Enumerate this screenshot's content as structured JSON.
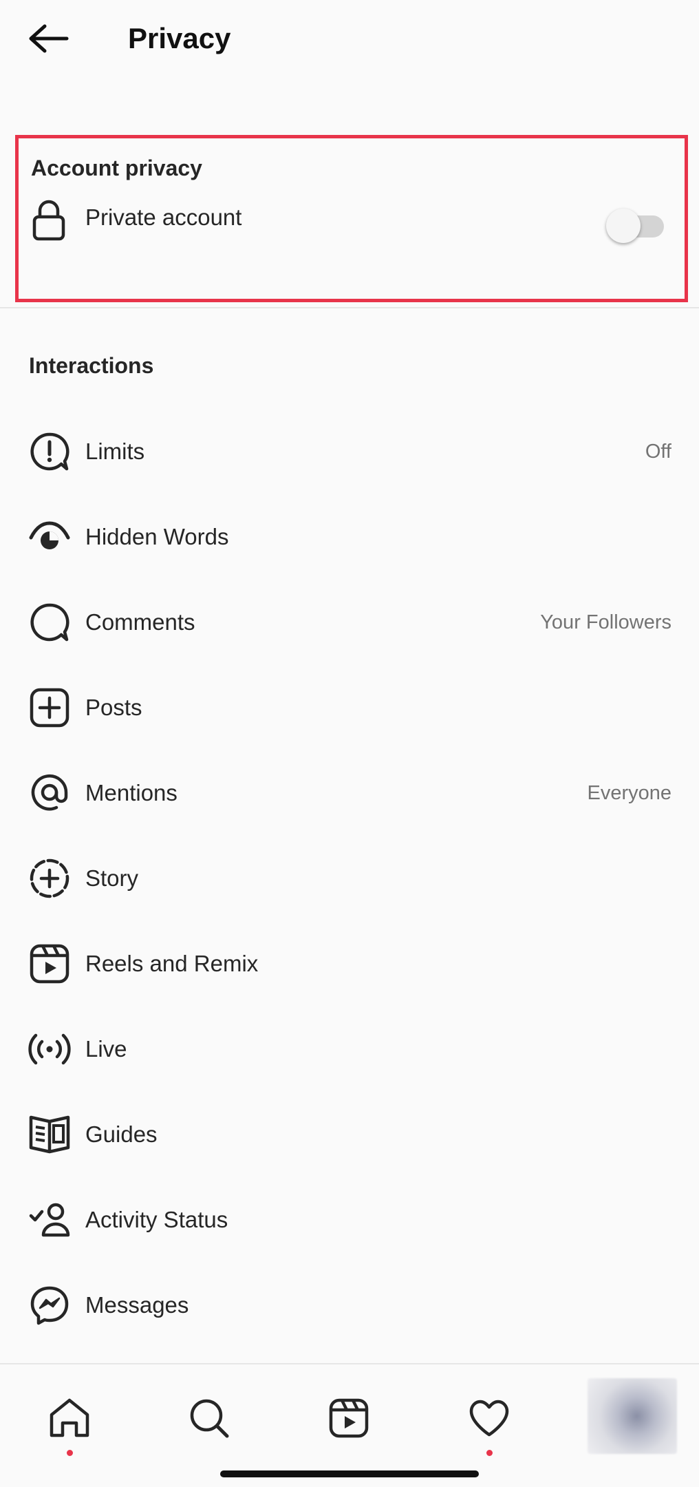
{
  "header": {
    "title": "Privacy",
    "back_icon": "arrow-left-icon"
  },
  "account_privacy": {
    "section_title": "Account privacy",
    "private_account": {
      "label": "Private account",
      "icon": "lock-icon",
      "enabled": false
    }
  },
  "interactions": {
    "section_title": "Interactions",
    "items": [
      {
        "label": "Limits",
        "value": "Off",
        "icon": "limits-icon"
      },
      {
        "label": "Hidden Words",
        "value": "",
        "icon": "hidden-words-icon"
      },
      {
        "label": "Comments",
        "value": "Your Followers",
        "icon": "comment-icon"
      },
      {
        "label": "Posts",
        "value": "",
        "icon": "add-post-icon"
      },
      {
        "label": "Mentions",
        "value": "Everyone",
        "icon": "at-sign-icon"
      },
      {
        "label": "Story",
        "value": "",
        "icon": "story-icon"
      },
      {
        "label": "Reels and Remix",
        "value": "",
        "icon": "reels-icon"
      },
      {
        "label": "Live",
        "value": "",
        "icon": "live-icon"
      },
      {
        "label": "Guides",
        "value": "",
        "icon": "guides-icon"
      },
      {
        "label": "Activity Status",
        "value": "",
        "icon": "activity-status-icon"
      },
      {
        "label": "Messages",
        "value": "",
        "icon": "messenger-icon"
      }
    ]
  },
  "bottom_nav": {
    "items": [
      "home-icon",
      "search-icon",
      "reels-icon",
      "heart-icon",
      "profile-avatar"
    ],
    "notification_color": "#e8344a"
  },
  "colors": {
    "highlight_border": "#e8344a",
    "text_primary": "#262626",
    "text_secondary": "#737373"
  }
}
